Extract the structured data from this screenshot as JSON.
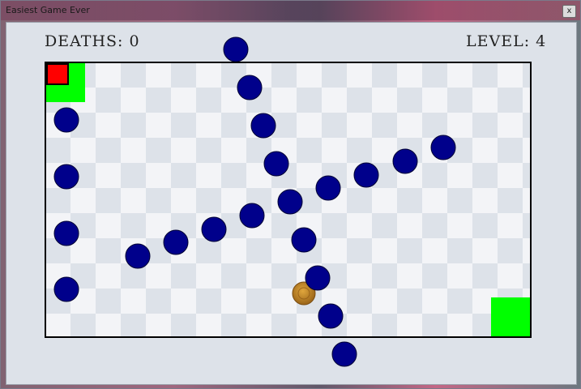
{
  "window": {
    "title": "Easiest Game Ever",
    "close_label": "x"
  },
  "hud": {
    "deaths_text": "DEATHS: 0",
    "level_text": "LEVEL: 4"
  },
  "colors": {
    "enemy": "#00008b",
    "player": "#ff0000",
    "zone": "#00ff00",
    "coin": "#c4882c",
    "tile_light": "#f3f4f7",
    "tile_dark": "#dde2e9"
  },
  "entities": {
    "player": "red square",
    "start_zone": "green zone",
    "goal_zone": "green zone",
    "coin": "gold coin",
    "enemy_count": 20
  }
}
